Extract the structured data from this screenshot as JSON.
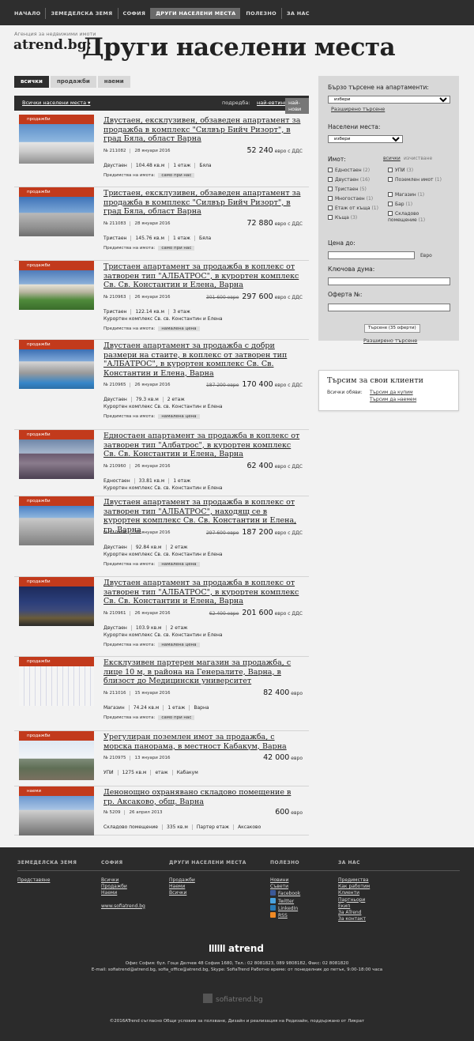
{
  "nav": [
    "НАЧАЛО",
    "ЗЕМЕДЕЛСКА ЗЕМЯ",
    "СОФИЯ",
    "ДРУГИ НАСЕЛЕНИ МЕСТА",
    "ПОЛЕЗНО",
    "ЗА НАС"
  ],
  "header": {
    "tagline": "Агенция за недвижими имоти",
    "brand": "atrend.bg:",
    "title": "Други населени места"
  },
  "tabs": [
    "всички",
    "продажби",
    "наеми"
  ],
  "listbar": {
    "location": "Всички населени места ▾",
    "sort_label": "подредба:",
    "sort_cheap": "най-евтини",
    "sort_new": "най-нови"
  },
  "listings": [
    {
      "tag": "продажби",
      "title": "Двустаен, ексклузивен, обзаведен апартамент за продажба в комплекс \"Силвър Бийч Ризорт\", в град Бяла, област Варна",
      "id": "№ 211082",
      "date": "28 януари 2016",
      "old_price": "",
      "price": "52 240",
      "suffix": "евро с ДДС",
      "specs": [
        "Двустаен",
        "104.48 кв.м",
        "1 етаж",
        "Бяла"
      ],
      "addr": "",
      "adv_label": "Предимства на имота:",
      "adv": "само при нас"
    },
    {
      "tag": "продажби",
      "title": "Тристаен, ексклузивен, обзаведен апартамент за продажба в комплекс \"Силвър Бийч Ризорт\", в град Бяла, област Варна",
      "id": "№ 211083",
      "date": "28 януари 2016",
      "old_price": "",
      "price": "72 880",
      "suffix": "евро с ДДС",
      "specs": [
        "Тристаен",
        "145.76 кв.м",
        "1 етаж",
        "Бяла"
      ],
      "addr": "",
      "adv_label": "Предимства на имота:",
      "adv": "само при нас"
    },
    {
      "tag": "продажби",
      "title": "Тристаен апартамент за продажба в коплекс от затворен тип \"АЛБАТРОС\", в курортен комплекс Св. Св. Константин и Елена, Варна",
      "id": "№ 210963",
      "date": "26 януари 2016",
      "old_price": "301 600 евро",
      "price": "297 600",
      "suffix": "евро с ДДС",
      "specs": [
        "Тристаен",
        "122.14 кв.м",
        "3 етаж"
      ],
      "addr": "Курортен комплекс Св. св. Константин и Елена",
      "adv_label": "Предимства на имота:",
      "adv": "намалена цена"
    },
    {
      "tag": "продажби",
      "title": "Двустаен апартамент за продажба с добри размери на стаите, в коплекс от затворен тип \"АЛБАТРОС\", в курортен комплекс Св. Св. Константин и Елена, Варна",
      "id": "№ 210965",
      "date": "26 януари 2016",
      "old_price": "187 200 евро",
      "price": "170 400",
      "suffix": "евро с ДДС",
      "specs": [
        "Двустаен",
        "79.3 кв.м",
        "2 етаж"
      ],
      "addr": "Курортен комплекс Св. св. Константин и Елена",
      "adv_label": "Предимства на имота:",
      "adv": "намалена цена"
    },
    {
      "tag": "продажби",
      "title": "Едностаен апартамент за продажба в коплекс от затворен тип \"Албатрос\", в курортен комплекс Св. Св. Константин и Елена, Варна",
      "id": "№ 210960",
      "date": "26 януари 2016",
      "old_price": "",
      "price": "62 400",
      "suffix": "евро с ДДС",
      "specs": [
        "Едностаен",
        "33.81 кв.м",
        "1 етаж"
      ],
      "addr": "Курортен комплекс Св. св. Константин и Елена",
      "adv_label": "",
      "adv": ""
    },
    {
      "tag": "продажби",
      "title": "Двустаен апартамент за продажба в коплекс от затворен тип \"АЛБАТРОС\", находящ се в курортен комплекс Св. Св. Константин и Елена, гр. Варна",
      "id": "№ 210964",
      "date": "26 януари 2016",
      "old_price": "297 600 евро",
      "price": "187 200",
      "suffix": "евро с ДДС",
      "specs": [
        "Двустаен",
        "92.84 кв.м",
        "2 етаж"
      ],
      "addr": "Курортен комплекс Св. св. Константин и Елена",
      "adv_label": "Предимства на имота:",
      "adv": "намалена цена"
    },
    {
      "tag": "продажби",
      "title": "Двустаен апартамент за продажба в коплекс от затворен тип \"АЛБАТРОС\", в курортен комплекс Св. Св. Константин и Елена, Варна",
      "id": "№ 210961",
      "date": "26 януари 2016",
      "old_price": "62 400 евро",
      "price": "201 600",
      "suffix": "евро с ДДС",
      "specs": [
        "Двустаен",
        "103.9 кв.м",
        "2 етаж"
      ],
      "addr": "Курортен комплекс Св. св. Константин и Елена",
      "adv_label": "Предимства на имота:",
      "adv": "намалена цена"
    },
    {
      "tag": "продажби",
      "title": "Ексклузивен партерен магазин за продажба, с лице 10 м, в района на Генералите, Варна, в близост до Медицински университет",
      "id": "№ 211016",
      "date": "15 януари 2016",
      "old_price": "",
      "price": "82 400",
      "suffix": "евро",
      "specs": [
        "Магазин",
        "74.24 кв.м",
        "1 етаж",
        "Варна"
      ],
      "addr": "",
      "adv_label": "Предимства на имота:",
      "adv": "само при нас"
    },
    {
      "tag": "продажби",
      "title": "Урегулиран поземлен имот за продажба, с морска панорама, в местност Кабакум, Варна",
      "id": "№ 210975",
      "date": "13 януари 2016",
      "old_price": "",
      "price": "42 000",
      "suffix": "евро",
      "specs": [
        "УПИ",
        "1275 кв.м",
        "етаж",
        "Кабакум"
      ],
      "addr": "",
      "adv_label": "",
      "adv": ""
    },
    {
      "tag": "наеми",
      "title": "Денонощно охранявано складово помещение в гр. Аксаково, общ. Варна",
      "id": "№ 5209",
      "date": "26 април 2013",
      "old_price": "",
      "price": "600",
      "suffix": "евро",
      "specs": [
        "Складово помещение",
        "335 кв.м",
        "Партер етаж",
        "Аксаково"
      ],
      "addr": "",
      "adv_label": "",
      "adv": ""
    }
  ],
  "search": {
    "quick_label": "Бързо търсене на апартаменти:",
    "select_placeholder": "избери",
    "advanced": "Разширено търсене",
    "places_label": "Населени места:",
    "places_select": "избери",
    "type_label": "Имот:",
    "all": "всички",
    "clear": "изчистване",
    "types_left": [
      [
        "Едностаен",
        "(2)"
      ],
      [
        "Двустаен",
        "(16)"
      ],
      [
        "Тристаен",
        "(5)"
      ],
      [
        "Многостаен",
        "(1)"
      ],
      [
        "Етаж от къща",
        "(1)"
      ],
      [
        "Къща",
        "(3)"
      ]
    ],
    "types_right": [
      [
        "УПИ",
        "(3)"
      ],
      [
        "Поземлен имот",
        "(1)"
      ],
      [
        "Магазин",
        "(1)"
      ],
      [
        "Бар",
        "(1)"
      ],
      [
        "Складово помещение",
        "(1)"
      ]
    ],
    "price_label": "Цена до:",
    "price_unit": "Евро",
    "keyword_label": "Ключова дума:",
    "offer_label": "Оферта №:",
    "button": "Търсене (35 оферти)",
    "advanced2": "Разширено търсене"
  },
  "clients": {
    "title": "Търсим за свои клиенти",
    "label": "Всички обяви:",
    "buy": "Търсим да купим",
    "rent": "Търсим да наемем"
  },
  "footer": {
    "cols": [
      {
        "h": "ЗЕМЕДЕЛСКА ЗЕМЯ",
        "links": [
          "Представяне"
        ]
      },
      {
        "h": "СОФИЯ",
        "links": [
          "Всички",
          "Продажби",
          "Наеми",
          "",
          "www.sofiatrend.bg"
        ]
      },
      {
        "h": "ДРУГИ НАСЕЛЕНИ МЕСТА",
        "links": [
          "Продажби",
          "Наеми",
          "Всички"
        ]
      },
      {
        "h": "ПОЛЕЗНО",
        "links": [
          "Новини",
          "Съвети",
          "Facebook",
          "Twitter",
          "LinkedIn",
          "RSS"
        ]
      },
      {
        "h": "ЗА НАС",
        "links": [
          "Предимства",
          "Как работим",
          "Клиенти",
          "Партньори",
          "Екип",
          "За ATrend",
          "За контакт"
        ]
      }
    ],
    "logo": "atrend",
    "address": "Офис София: бул. Гоце Делчев 48 София 1680, Тел.: 02 8081823, 089 9808182, Факс: 02 8081820",
    "email": "E-mail: sofiatrend@atrend.bg, sofia_office@atrend.bg, Skype: SofiaTrend Работно време: от понеделник до петък, 9:00-18:00 часа",
    "sofia": "sofiatrend.bg",
    "copyright": "©2016ATrend съгласно Общи условия за ползване, Дизайн и реализация на Редизайн, поддържано от Ликрат"
  }
}
